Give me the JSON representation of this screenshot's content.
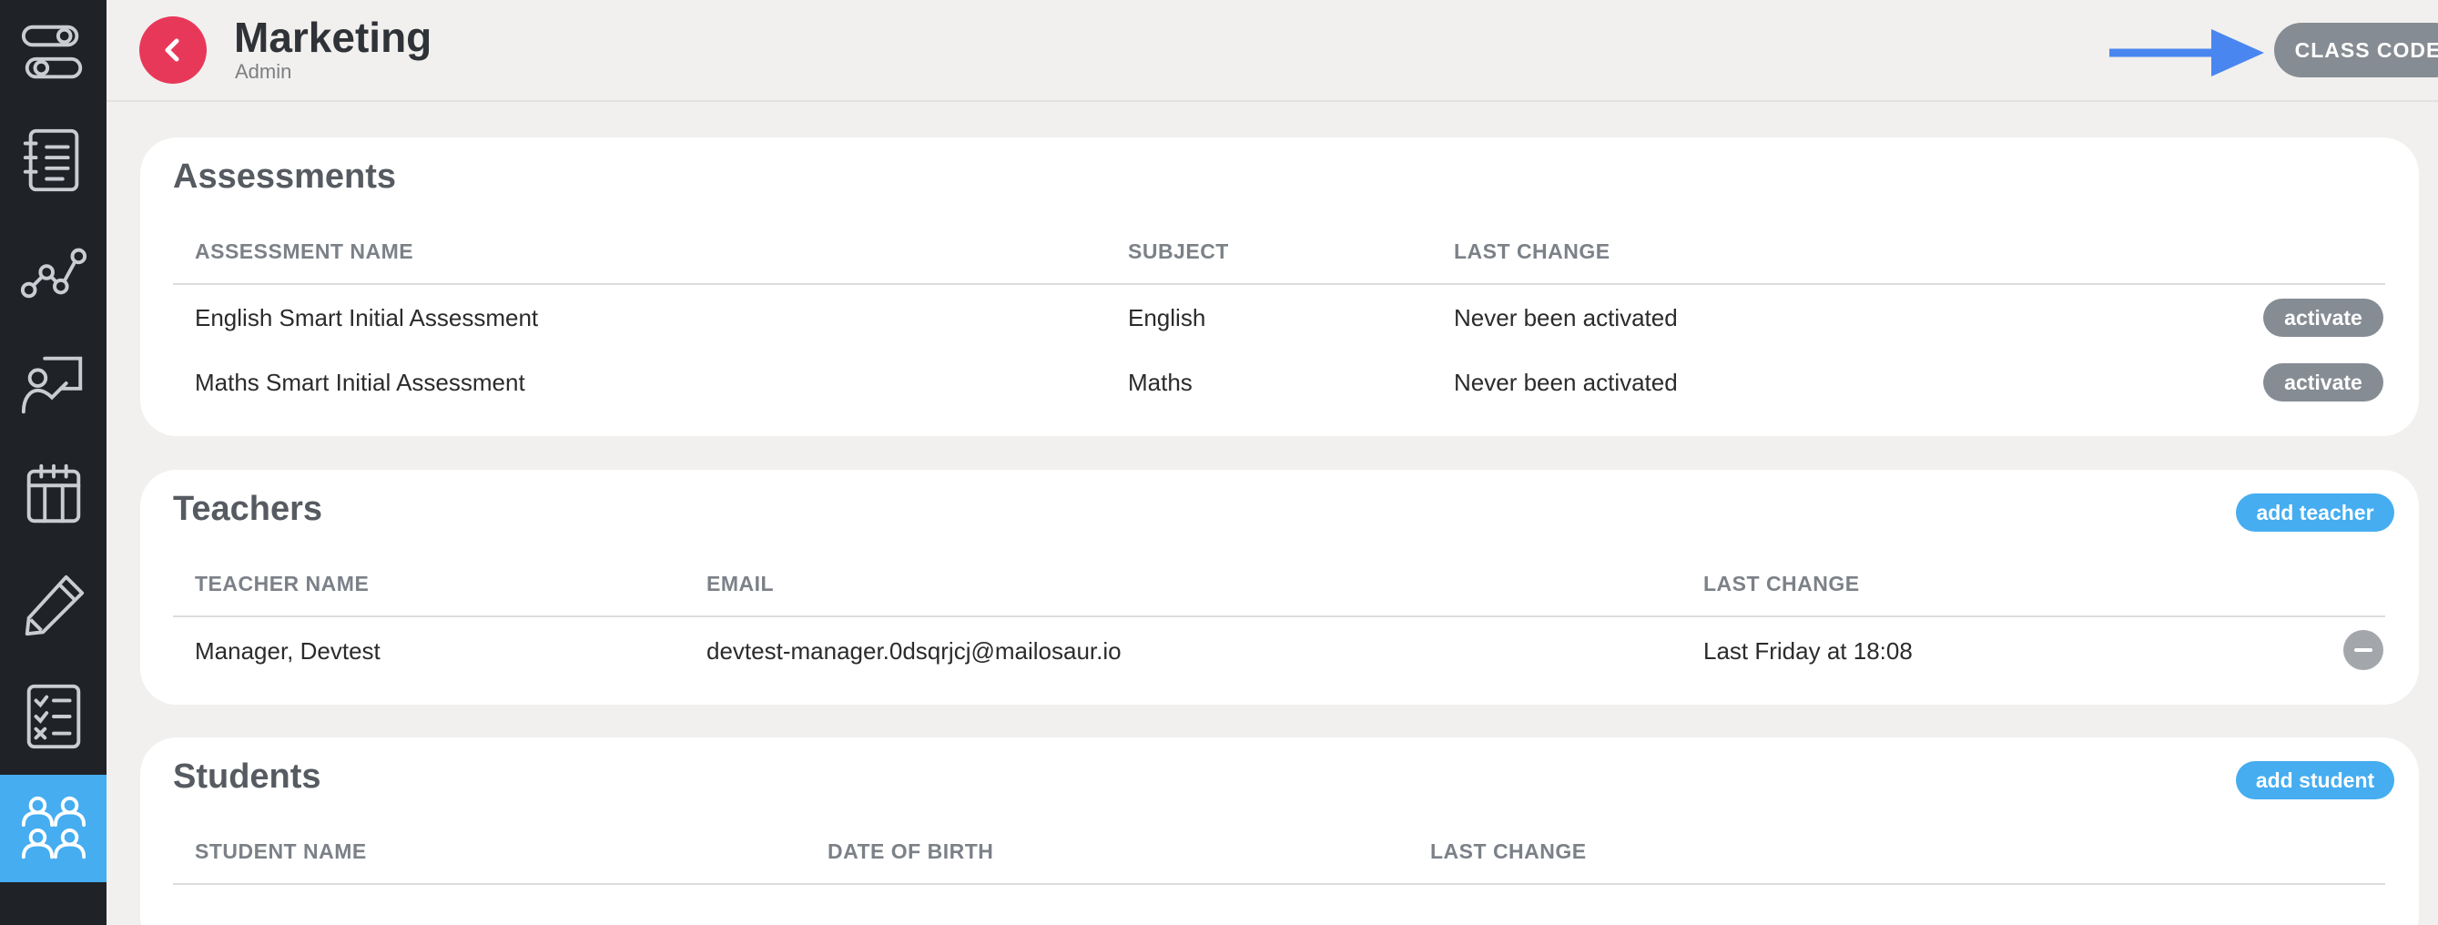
{
  "header": {
    "title": "Marketing",
    "subtitle": "Admin",
    "class_code_label": "CLASS CODE",
    "more_label": "...",
    "back_icon": "chevron-left-icon"
  },
  "sidebar": {
    "items": [
      {
        "icon": "pathway-icon",
        "active": false
      },
      {
        "icon": "notebook-icon",
        "active": false
      },
      {
        "icon": "progress-graph-icon",
        "active": false
      },
      {
        "icon": "teacher-presentation-icon",
        "active": false
      },
      {
        "icon": "calendar-icon",
        "active": false
      },
      {
        "icon": "pencil-icon",
        "active": false
      },
      {
        "icon": "checklist-icon",
        "active": false
      },
      {
        "icon": "people-group-icon",
        "active": true
      }
    ]
  },
  "assessments": {
    "title": "Assessments",
    "columns": [
      "ASSESSMENT NAME",
      "SUBJECT",
      "LAST CHANGE"
    ],
    "rows": [
      {
        "name": "English Smart Initial Assessment",
        "subject": "English",
        "last_change": "Never been activated",
        "action": "activate"
      },
      {
        "name": "Maths Smart Initial Assessment",
        "subject": "Maths",
        "last_change": "Never been activated",
        "action": "activate"
      }
    ]
  },
  "teachers": {
    "title": "Teachers",
    "add_label": "add teacher",
    "columns": [
      "TEACHER NAME",
      "EMAIL",
      "LAST CHANGE"
    ],
    "rows": [
      {
        "name": "Manager, Devtest",
        "email": "devtest-manager.0dsqrjcj@mailosaur.io",
        "last_change": "Last Friday at 18:08"
      }
    ]
  },
  "students": {
    "title": "Students",
    "add_label": "add student",
    "columns": [
      "STUDENT NAME",
      "DATE OF BIRTH",
      "LAST CHANGE"
    ],
    "rows": []
  },
  "colors": {
    "sidebar_bg": "#1f2327",
    "active_nav": "#45adf0",
    "back_button": "#e8385a",
    "gray_button": "#868c93",
    "blue_button": "#45adf0",
    "arrow": "#4a86f0"
  }
}
